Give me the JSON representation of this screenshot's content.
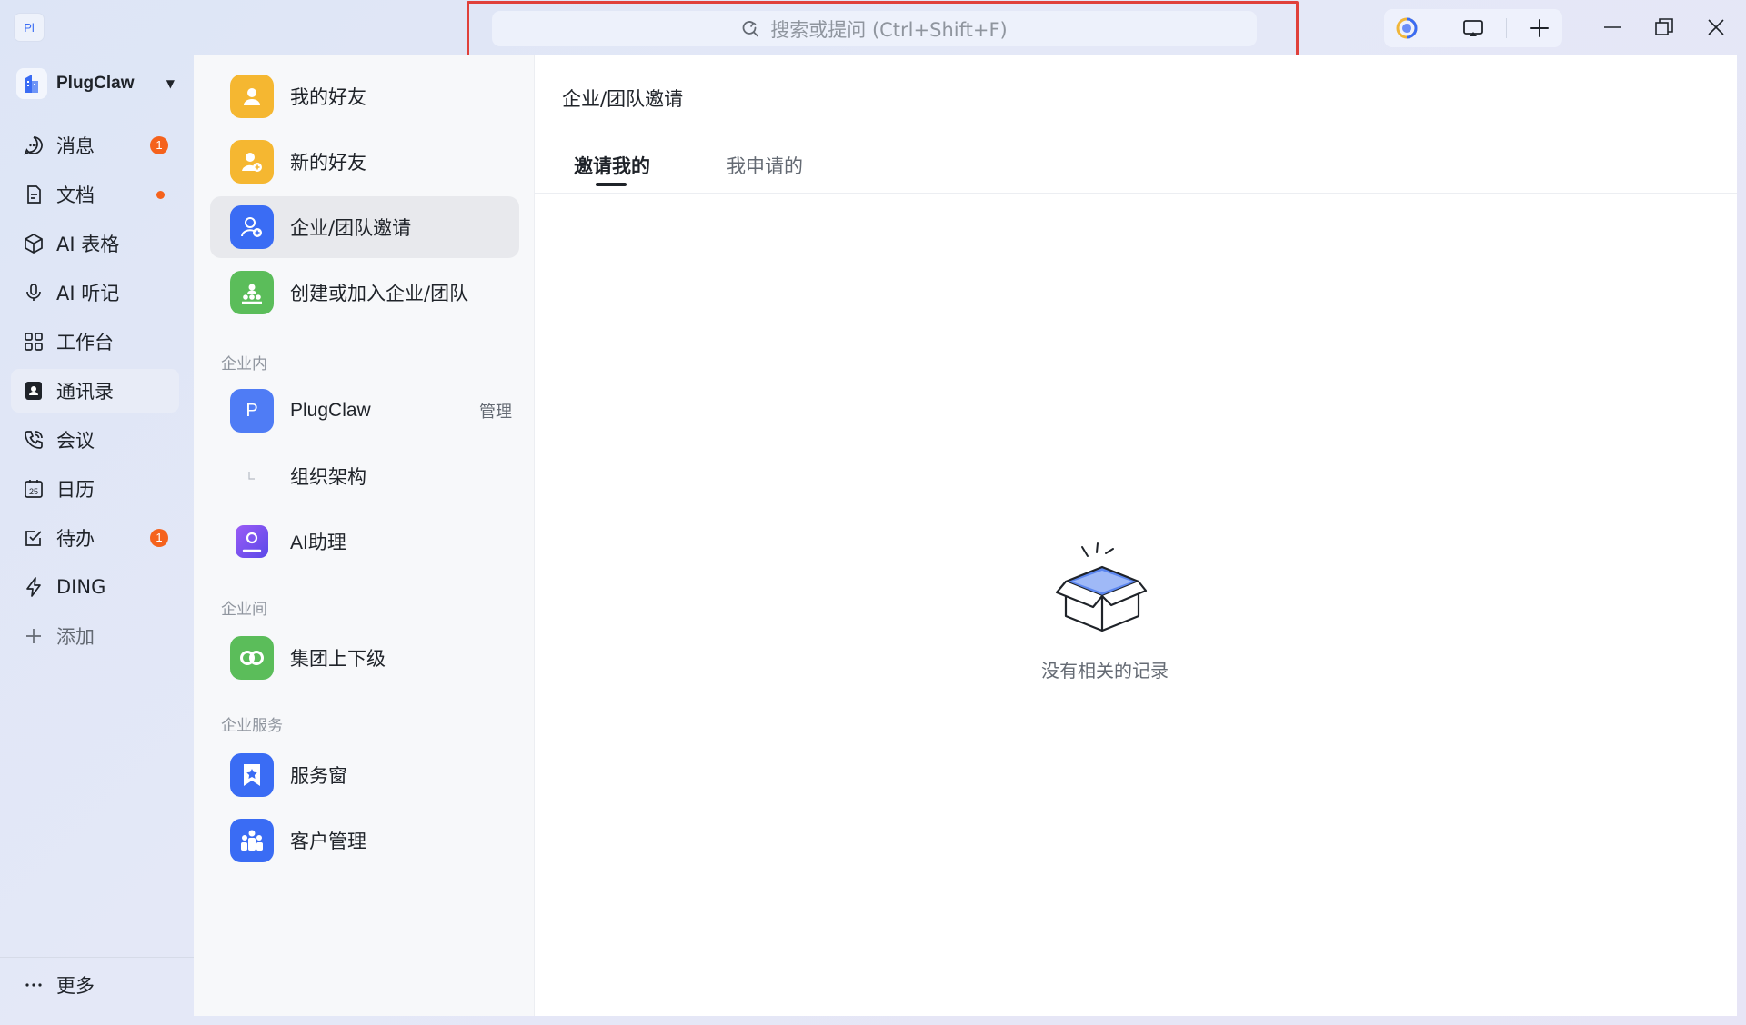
{
  "titlebar": {
    "logo_text": "Pl",
    "search_placeholder": "搜索或提问 (Ctrl+Shift+F)"
  },
  "org": {
    "name": "PlugClaw"
  },
  "nav": {
    "items": [
      {
        "label": "消息",
        "badge": "1"
      },
      {
        "label": "文档"
      },
      {
        "label": "AI 表格"
      },
      {
        "label": "AI 听记"
      },
      {
        "label": "工作台"
      },
      {
        "label": "通讯录"
      },
      {
        "label": "会议"
      },
      {
        "label": "日历"
      },
      {
        "label": "待办",
        "badge": "1"
      },
      {
        "label": "DING"
      },
      {
        "label": "添加"
      }
    ],
    "more_label": "更多",
    "calendar_day": "25"
  },
  "contacts": {
    "my_friends": "我的好友",
    "new_friends": "新的好友",
    "org_invites": "企业/团队邀请",
    "create_join": "创建或加入企业/团队",
    "section_inside": "企业内",
    "org_avatar_letter": "P",
    "org_name": "PlugClaw",
    "manage": "管理",
    "org_structure": "组织架构",
    "ai_assistant": "AI助理",
    "section_between": "企业间",
    "group_hierarchy": "集团上下级",
    "section_services": "企业服务",
    "service_window": "服务窗",
    "customer_mgmt": "客户管理"
  },
  "main": {
    "title": "企业/团队邀请",
    "tabs": [
      {
        "label": "邀请我的",
        "active": true
      },
      {
        "label": "我申请的",
        "active": false
      }
    ],
    "empty_text": "没有相关的记录"
  },
  "colors": {
    "accent_blue": "#3a6cf4",
    "badge_orange": "#f5621c",
    "highlight_red": "#e0403a",
    "friend_yellow": "#f5b731",
    "green": "#5bbd5a",
    "purple": "#7a4cf0"
  }
}
